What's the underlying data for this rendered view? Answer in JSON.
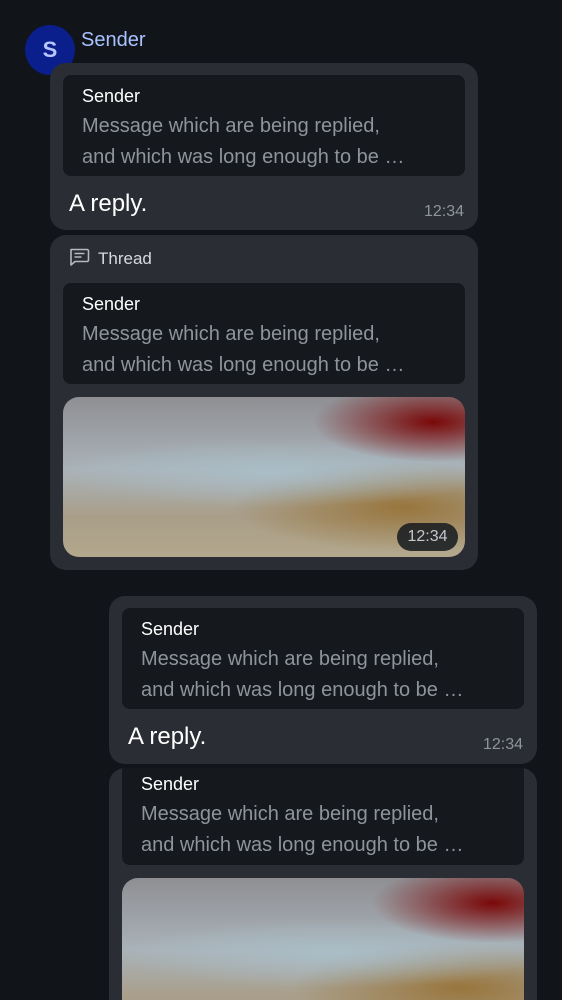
{
  "sender": {
    "avatar_letter": "S",
    "name": "Sender"
  },
  "thread": {
    "label": "Thread",
    "icon": "thread-icon"
  },
  "messages": [
    {
      "reply_to": {
        "sender": "Sender",
        "preview": "Message which are being replied,\nand which was long enough to be …"
      },
      "text": "A reply.",
      "time": "12:34"
    },
    {
      "reply_to": {
        "sender": "Sender",
        "preview": "Message which are being replied,\nand which was long enough to be …"
      },
      "time": "12:34"
    },
    {
      "reply_to": {
        "sender": "Sender",
        "preview": "Message which are being replied,\nand which was long enough to be …"
      },
      "text": "A reply.",
      "time": "12:34"
    },
    {
      "reply_to": {
        "sender": "Sender",
        "preview": "Message which are being replied,\nand which was long enough to be …"
      }
    }
  ]
}
